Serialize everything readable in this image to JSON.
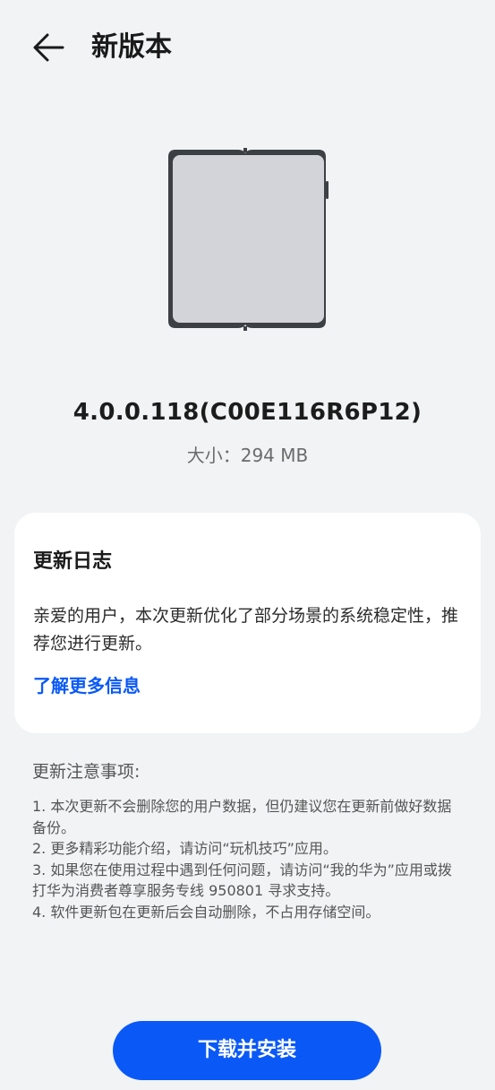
{
  "header": {
    "title": "新版本",
    "back_icon": "arrow-left-icon"
  },
  "device": {
    "icon": "foldable-phone-icon"
  },
  "version": {
    "number": "4.0.0.118(C00E116R6P12)",
    "size": "大小：294 MB"
  },
  "changelog": {
    "title": "更新日志",
    "body": "亲爱的用户，本次更新优化了部分场景的系统稳定性，推荐您进行更新。",
    "link": "了解更多信息"
  },
  "notes": {
    "title": "更新注意事项:",
    "items": [
      "1. 本次更新不会删除您的用户数据，但仍建议您在更新前做好数据备份。",
      "2. 更多精彩功能介绍，请访问“玩机技巧”应用。",
      "3. 如果您在使用过程中遇到任何问题，请访问“我的华为”应用或拨打华为消费者尊享服务专线 950801 寻求支持。",
      "4. 软件更新包在更新后会自动删除，不占用存储空间。"
    ]
  },
  "action": {
    "install_label": "下载并安装"
  },
  "colors": {
    "background": "#f1f3f5",
    "accent": "#0a59f7",
    "card": "#ffffff"
  }
}
